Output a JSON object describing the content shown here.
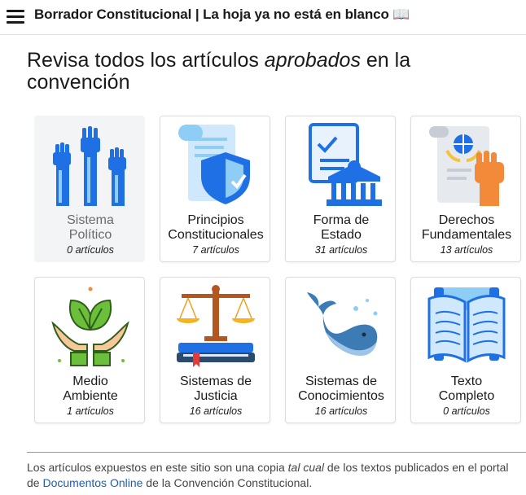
{
  "header": {
    "app_title": "Borrador Constitucional | La hoja ya no está en blanco 📖"
  },
  "main": {
    "heading_before": "Revisa todos los artículos ",
    "heading_emph": "aprobados",
    "heading_after": " en la convención"
  },
  "cards": [
    {
      "line1": "Sistema",
      "line2": "Político",
      "count": "0 artículos",
      "icon": "raised-fists-icon"
    },
    {
      "line1": "Principios",
      "line2": "Constitucionales",
      "count": "7 artículos",
      "icon": "scroll-shield-icon"
    },
    {
      "line1": "Forma de",
      "line2": "Estado",
      "count": "31 artículos",
      "icon": "document-government-building-icon"
    },
    {
      "line1": "Derechos",
      "line2": "Fundamentales",
      "count": "13 artículos",
      "icon": "charter-fist-icon"
    },
    {
      "line1": "Medio",
      "line2": "Ambiente",
      "count": "1 artículos",
      "icon": "hands-leaves-icon"
    },
    {
      "line1": "Sistemas de",
      "line2": "Justicia",
      "count": "16 artículos",
      "icon": "scales-books-icon"
    },
    {
      "line1": "Sistemas de",
      "line2": "Conocimientos",
      "count": "16 artículos",
      "icon": "whale-icon"
    },
    {
      "line1": "Texto",
      "line2": "Completo",
      "count": "0 artículos",
      "icon": "open-book-icon"
    }
  ],
  "footer": {
    "text_1": "Los artículos expuestos en este sitio son una copia ",
    "text_emph": "tal cual",
    "text_2": " de los textos publicados en el portal de ",
    "link_label": "Documentos Online",
    "text_3": " de la Convención Constitucional."
  },
  "colors": {
    "icon_blue": "#1f6fe5",
    "icon_light_blue": "#8ecdf5",
    "icon_orange": "#f28a3a",
    "icon_green": "#6bbf3a",
    "link": "#1a5fb4"
  }
}
